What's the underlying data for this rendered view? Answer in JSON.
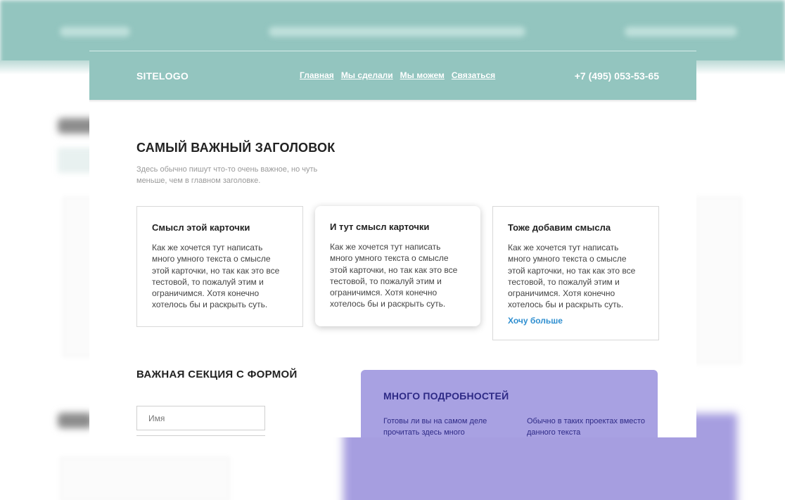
{
  "header": {
    "logo": "SITELOGO",
    "nav": [
      "Главная",
      "Мы сделали",
      "Мы можем",
      "Связаться"
    ],
    "phone": "+7 (495) 053-53-65"
  },
  "hero": {
    "title": "САМЫЙ ВАЖНЫЙ ЗАГОЛОВОК",
    "subtitle": "Здесь обычно пишут что-то очень важное, но чуть меньше, чем в главном заголовке."
  },
  "cards": [
    {
      "title": "Смысл этой карточки",
      "text": "Как же хочется тут написать много умного текста о смысле этой карточки, но так как это все тестовой, то пожалуй этим и ограничимся. Хотя конечно хотелось бы и раскрыть суть."
    },
    {
      "title": "И тут смысл карточки",
      "text": "Как же хочется тут написать много умного текста о смысле этой карточки, но так как это все тестовой, то пожалуй этим и ограничимся. Хотя конечно хотелось бы и раскрыть суть."
    },
    {
      "title": "Тоже добавим смысла",
      "text": "Как же хочется тут написать много умного текста о смысле этой карточки, но так как это все тестовой, то пожалуй этим и ограничимся. Хотя конечно хотелось бы и раскрыть суть.",
      "link": "Хочу больше"
    }
  ],
  "form_section": {
    "title": "ВАЖНАЯ СЕКЦИЯ С ФОРМОЙ",
    "name_placeholder": "Имя"
  },
  "details": {
    "title": "МНОГО ПОДРОБНОСТЕЙ",
    "col1": "Готовы ли вы на самом деле прочитать здесь много",
    "col2": "Обычно в таких проектах вместо данного текста"
  },
  "colors": {
    "header_bg": "#93c5bf",
    "details_bg": "#a8a1e2",
    "details_text": "#2e2a86",
    "link": "#2f8fd0"
  }
}
